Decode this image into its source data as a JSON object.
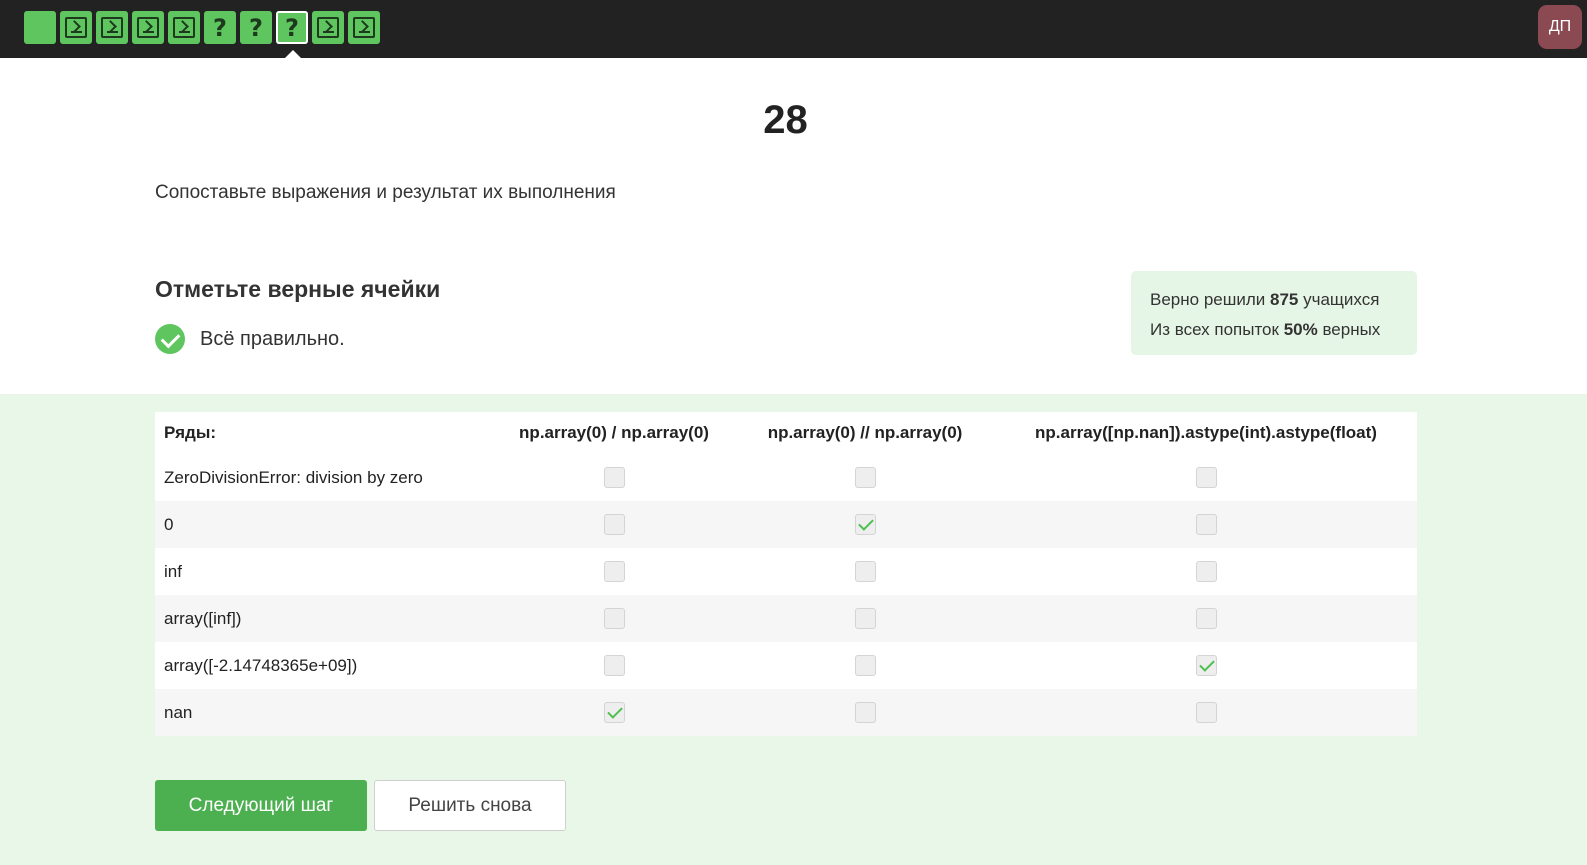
{
  "header": {
    "steps": [
      {
        "type": "text",
        "symbol": "",
        "active": false
      },
      {
        "type": "code",
        "symbol": "",
        "active": false
      },
      {
        "type": "code",
        "symbol": "",
        "active": false
      },
      {
        "type": "code",
        "symbol": "",
        "active": false
      },
      {
        "type": "code",
        "symbol": "",
        "active": false
      },
      {
        "type": "quiz",
        "symbol": "?",
        "active": false
      },
      {
        "type": "quiz",
        "symbol": "?",
        "active": false
      },
      {
        "type": "quiz",
        "symbol": "?",
        "active": true
      },
      {
        "type": "code",
        "symbol": "",
        "active": false
      },
      {
        "type": "code",
        "symbol": "",
        "active": false
      }
    ],
    "avatar_initials": "ДП"
  },
  "colors": {
    "topbar": "#222222",
    "step_passed": "#5fc65f",
    "avatar": "#8b4a52",
    "accent_green": "#4caf50",
    "success_bg": "#e9f7e9"
  },
  "step": {
    "number": "28",
    "task_text": "Сопоставьте выражения и результат их выполнения",
    "section_title": "Отметьте верные ячейки",
    "result_text": "Всё правильно."
  },
  "stats": {
    "line1_prefix": "Верно решили ",
    "line1_count": "875",
    "line1_suffix": " учащихся",
    "line2_prefix": "Из всех попыток ",
    "line2_percent": "50%",
    "line2_suffix": " верных"
  },
  "matrix": {
    "row_header": "Ряды:",
    "columns": [
      "np.array(0) / np.array(0)",
      "np.array(0) // np.array(0)",
      "np.array([np.nan]).astype(int).astype(float)"
    ],
    "rows": [
      {
        "label": "ZeroDivisionError: division by zero",
        "checked": [
          false,
          false,
          false
        ]
      },
      {
        "label": "0",
        "checked": [
          false,
          true,
          false
        ]
      },
      {
        "label": "inf",
        "checked": [
          false,
          false,
          false
        ]
      },
      {
        "label": "array([inf])",
        "checked": [
          false,
          false,
          false
        ]
      },
      {
        "label": "array([-2.14748365e+09])",
        "checked": [
          false,
          false,
          true
        ]
      },
      {
        "label": "nan",
        "checked": [
          true,
          false,
          false
        ]
      }
    ]
  },
  "buttons": {
    "next": "Следующий шаг",
    "retry": "Решить снова"
  }
}
